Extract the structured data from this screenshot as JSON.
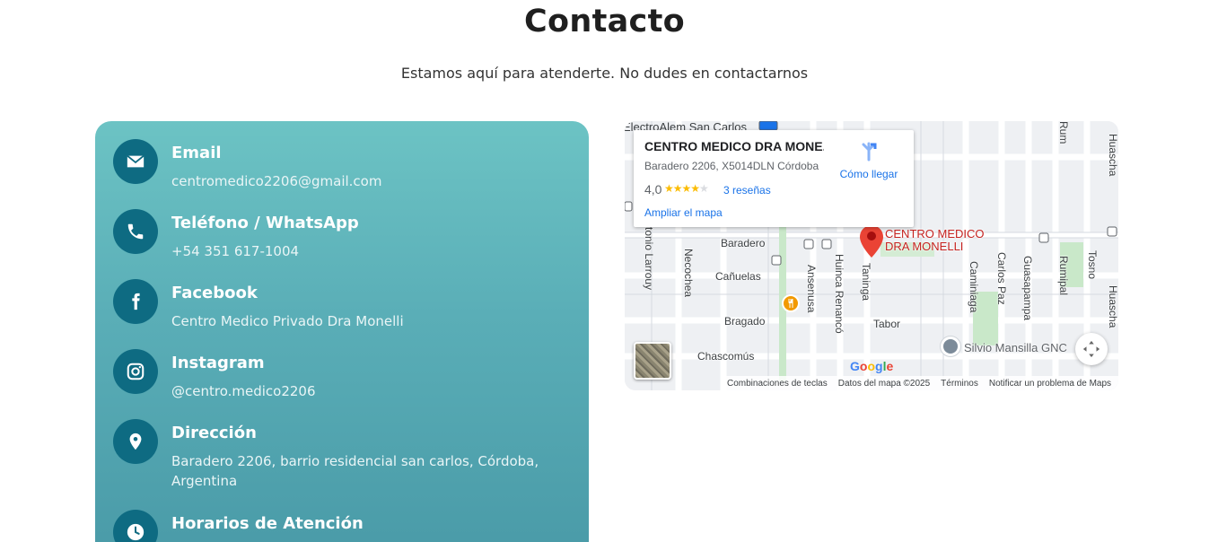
{
  "page": {
    "title": "Contacto",
    "subtitle": "Estamos aquí para atenderte. No dudes en contactarnos"
  },
  "contact": {
    "items": [
      {
        "icon": "envelope-icon",
        "title": "Email",
        "value": "centromedico2206@gmail.com"
      },
      {
        "icon": "phone-icon",
        "title": "Teléfono / WhatsApp",
        "value": "+54 351 617-1004"
      },
      {
        "icon": "facebook-icon",
        "title": "Facebook",
        "value": "Centro Medico Privado Dra Monelli"
      },
      {
        "icon": "instagram-icon",
        "title": "Instagram",
        "value": "@centro.medico2206"
      },
      {
        "icon": "location-pin-icon",
        "title": "Dirección",
        "value": "Baradero 2206, barrio residencial san carlos, Córdoba, Argentina"
      },
      {
        "icon": "clock-icon",
        "title": "Horarios de Atención",
        "value": ""
      }
    ],
    "colors": {
      "card_top": "#6cc3c4",
      "card_bottom": "#4a9ba8",
      "icon_bg": "#0e6b82"
    }
  },
  "map": {
    "place_name": "CENTRO MEDICO DRA MONE...",
    "address": "Baradero 2206, X5014DLN Córdoba",
    "rating": "4,0",
    "stars": 4,
    "reviews": "3 reseñas",
    "enlarge": "Ampliar el mapa",
    "directions": "Cómo llegar",
    "pin_label": "CENTRO MEDICO DRA MONELLI",
    "top_label": "ElectroAlem San Carlos",
    "streets": {
      "baradero": "Baradero",
      "canuelas": "Cañuelas",
      "bragado": "Bragado",
      "chascomus": "Chascomús",
      "tabor": "Tabor",
      "necochea": "Necochea",
      "larrouy": "tonio Larrouy",
      "ansenusa": "Ansenusa",
      "huinca": "Huinca Renancó",
      "taninga": "Taninga",
      "caminiaga": "Caminiaga",
      "carlospaz": "Carlos Paz",
      "guasapampa": "Guasapampa",
      "rumipal": "Rumipal",
      "tosno": "Tosno",
      "rum": "Rum",
      "huascha": "Huascha",
      "huascha2": "Huascha"
    },
    "poi": "Silvio Mansilla GNC",
    "google": "Google",
    "footer": [
      "Combinaciones de teclas",
      "Datos del mapa ©2025",
      "Términos",
      "Notificar un problema de Maps"
    ]
  }
}
